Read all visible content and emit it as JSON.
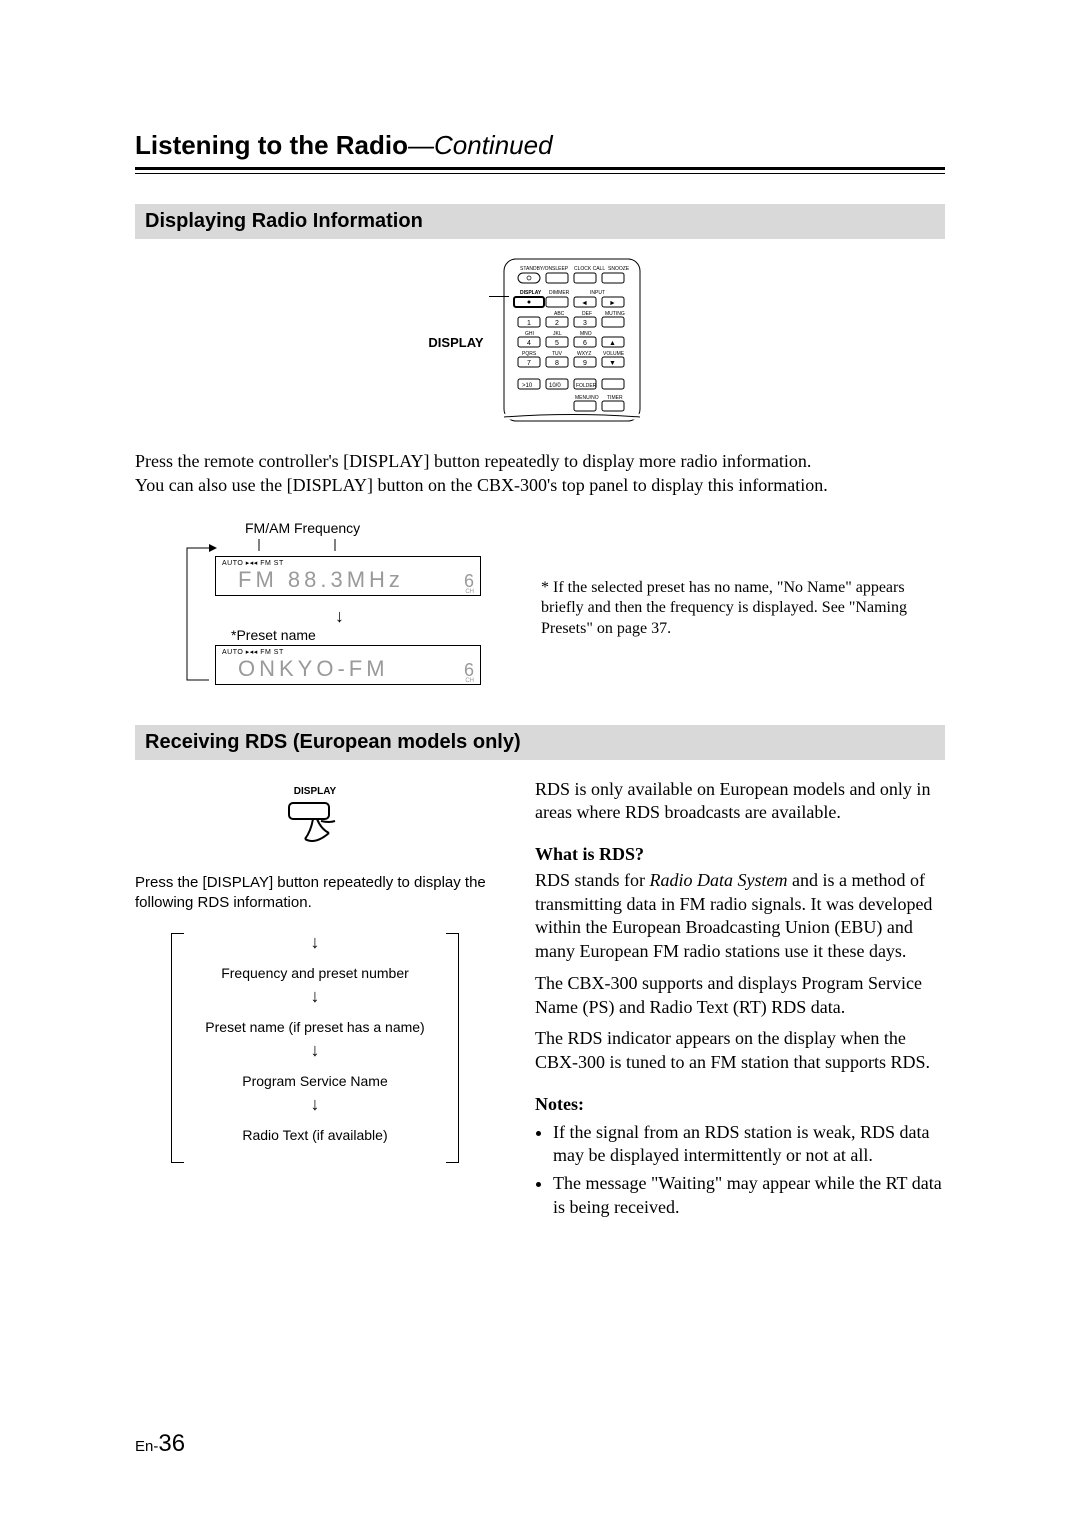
{
  "title": {
    "main": "Listening to the Radio",
    "suffix": "—Continued"
  },
  "section1": {
    "heading": "Displaying Radio Information",
    "remote_label": "DISPLAY",
    "body": "Press the remote controller's [DISPLAY] button repeatedly to display more radio information.\nYou can also use the [DISPLAY] button on the CBX-300's top panel to display this information.",
    "diagram": {
      "top_labels": "FM/AM   Frequency",
      "lcd1_top": "AUTO ▸◂◂   FM ST",
      "lcd1_seg": "FM   88.3MHz",
      "lcd1_ch": "6",
      "lcd1_chlab": "CH",
      "preset_label": "*Preset name",
      "lcd2_top": "AUTO ▸◂◂   FM ST",
      "lcd2_seg": "ONKYO-FM",
      "lcd2_ch": "6",
      "lcd2_chlab": "CH"
    },
    "footnote": "* If the selected preset has no name, \"No Name\" appears briefly and then the frequency is displayed. See \"Naming Presets\" on page 37."
  },
  "section2": {
    "heading": "Receiving RDS (European models only)",
    "display_icon_label": "DISPLAY",
    "instruction": "Press the [DISPLAY] button repeatedly to display the following RDS information.",
    "flow": [
      "Frequency and preset number",
      "Preset name (if preset has a name)",
      "Program Service Name",
      "Radio Text (if available)"
    ],
    "rds_intro": "RDS is only available on European models and only in areas where RDS broadcasts are available.",
    "what_heading": "What is RDS?",
    "what_p1a": "RDS stands for ",
    "what_em": "Radio Data System",
    "what_p1b": " and is a method of transmitting data in FM radio signals. It was developed within the European Broadcasting Union (EBU) and many European FM radio stations use it these days.",
    "what_p2": "The CBX-300 supports and displays Program Service Name (PS) and Radio Text (RT) RDS data.",
    "what_p3": "The RDS indicator appears on the display when the CBX-300 is tuned to an FM station that supports RDS.",
    "notes_heading": "Notes:",
    "notes": [
      "If the signal from an RDS station is weak, RDS data may be displayed intermittently or not at all.",
      "The message \"Waiting\" may appear while the RT data is being received."
    ]
  },
  "page": {
    "prefix": "En-",
    "num": "36"
  },
  "remote": {
    "row0": [
      "STANDBY/ON",
      "SLEEP",
      "CLOCK CALL",
      "SNOOZE"
    ],
    "row1": [
      "DISPLAY",
      "DIMMER",
      "INPUT",
      ""
    ],
    "row2": [
      "",
      "ABC",
      "DEF",
      "MUTING"
    ],
    "row3": [
      "1",
      "2",
      "3",
      ""
    ],
    "row4lab": [
      "GHI",
      "JKL",
      "MNO",
      ""
    ],
    "row4": [
      "4",
      "5",
      "6",
      "▲"
    ],
    "row5lab": [
      "PQRS",
      "TUV",
      "WXYZ",
      "VOLUME"
    ],
    "row5": [
      "7",
      "8",
      "9",
      "▼"
    ],
    "row6": [
      ">10",
      "10/0",
      "FOLDER",
      ""
    ],
    "row7": [
      "",
      "",
      "MENU/NO",
      "TIMER"
    ]
  }
}
